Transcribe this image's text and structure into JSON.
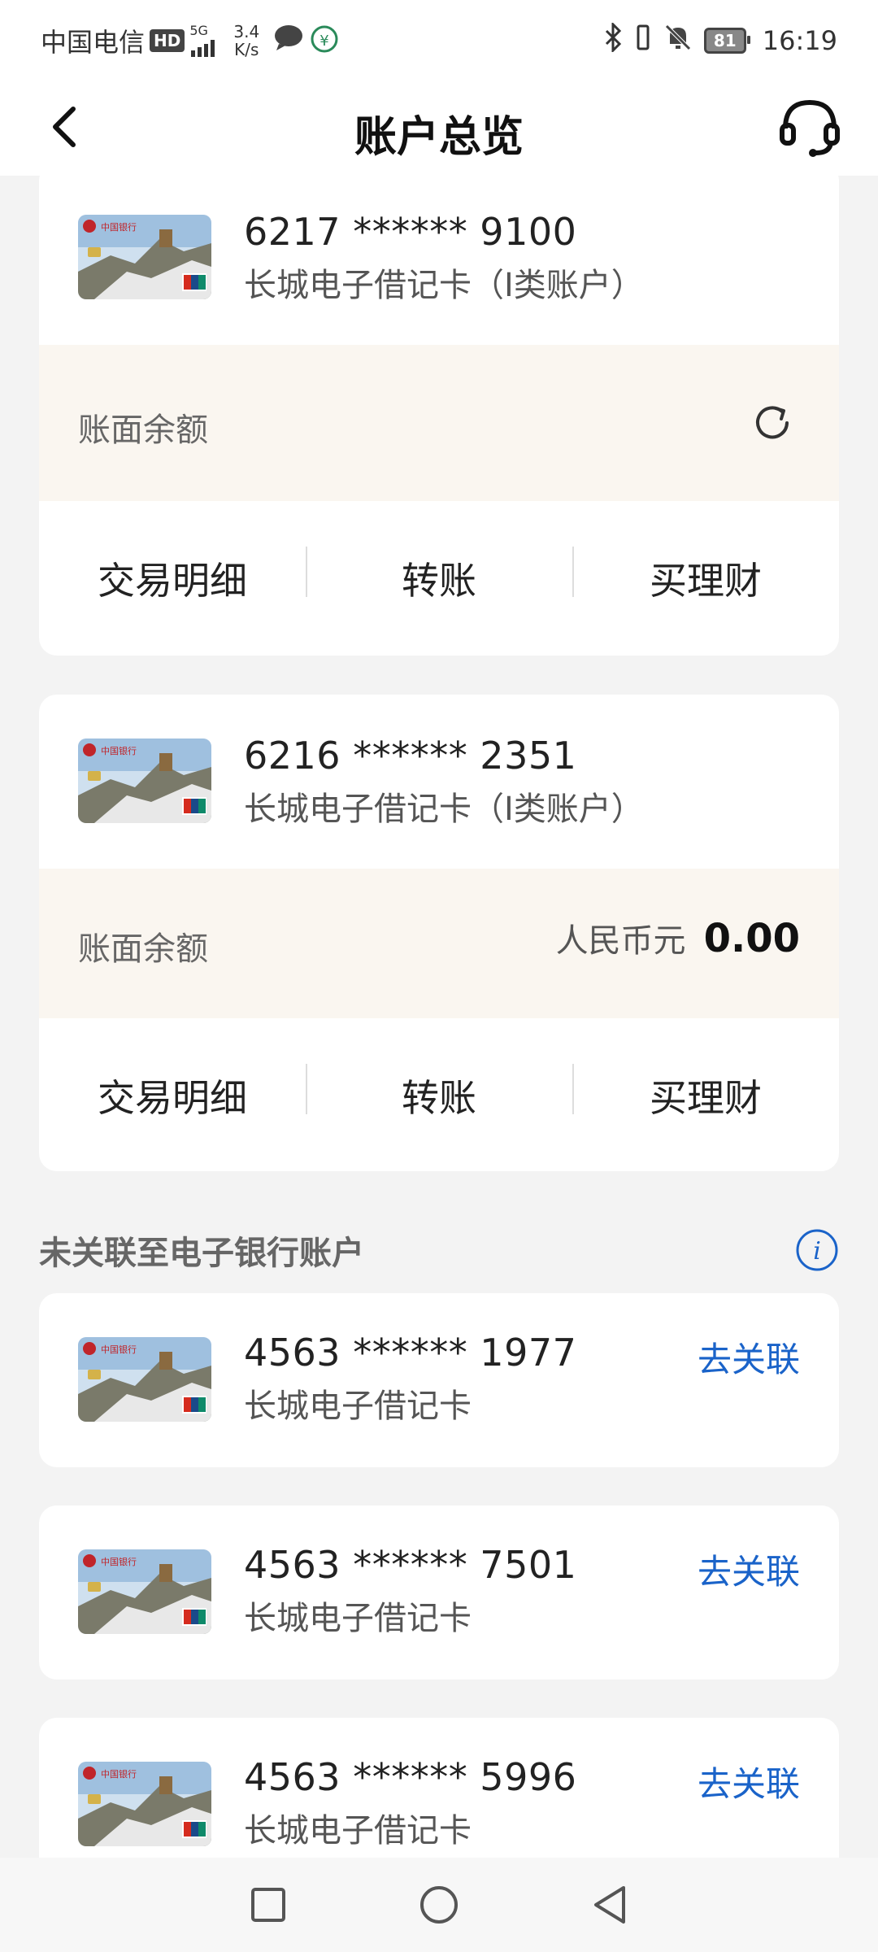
{
  "status_bar": {
    "carrier": "中国电信",
    "hd": "HD",
    "network": "5G",
    "speed_value": "3.4",
    "speed_unit": "K/s",
    "battery": "81",
    "time": "16:19"
  },
  "header": {
    "title": "账户总览"
  },
  "accounts": [
    {
      "number": "6217 ****** 9100",
      "type": "长城电子借记卡（I类账户）",
      "balance_label": "账面余额",
      "actions": [
        "交易明细",
        "转账",
        "买理财"
      ]
    },
    {
      "number": "6216 ****** 2351",
      "type": "长城电子借记卡（I类账户）",
      "balance_label": "账面余额",
      "currency": "人民币元",
      "balance": "0.00",
      "actions": [
        "交易明细",
        "转账",
        "买理财"
      ]
    }
  ],
  "unlinked_section": {
    "title": "未关联至电子银行账户",
    "link_label": "去关联",
    "cards": [
      {
        "number": "4563 ****** 1977",
        "type": "长城电子借记卡"
      },
      {
        "number": "4563 ****** 7501",
        "type": "长城电子借记卡"
      },
      {
        "number": "4563 ****** 5996",
        "type": "长城电子借记卡"
      }
    ]
  },
  "colors": {
    "accent_blue": "#1a63c9",
    "balance_bg": "#faf6f0",
    "page_bg": "#f3f3f3"
  }
}
